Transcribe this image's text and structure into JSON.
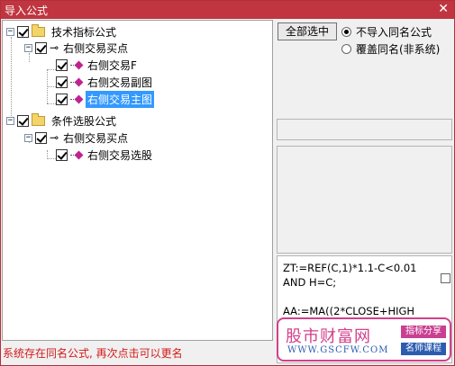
{
  "window": {
    "title": "导入公式",
    "close_glyph": "✕"
  },
  "tree": {
    "nodes": [
      {
        "label": "技术指标公式",
        "checked": true,
        "expander": "−",
        "icon": "folder-icon"
      },
      {
        "label": "右侧交易买点",
        "checked": true,
        "expander": "−",
        "icon": "key-icon"
      },
      {
        "label": "右侧交易F",
        "checked": true,
        "icon": "formula-pen-icon"
      },
      {
        "label": "右侧交易副图",
        "checked": true,
        "icon": "formula-pen-icon"
      },
      {
        "label": "右侧交易主图",
        "checked": true,
        "icon": "formula-pen-icon",
        "selected": true
      },
      {
        "label": "条件选股公式",
        "checked": true,
        "expander": "−",
        "icon": "folder-icon"
      },
      {
        "label": "右侧交易买点",
        "checked": true,
        "expander": "−",
        "icon": "key-icon"
      },
      {
        "label": "右侧交易选股",
        "checked": true,
        "icon": "formula-pen-icon"
      }
    ]
  },
  "buttons": {
    "select_all": "全部选中"
  },
  "options": {
    "no_import_same": "不导入同名公式",
    "overwrite_same": "覆盖同名(非系统)",
    "selected": "no_import_same"
  },
  "code_lines": [
    "ZT:=REF(C,1)*1.1-C<0.01",
    "AND H=C;",
    "",
    "AA:=MA((2*CLOSE+HIGH"
  ],
  "status": "系统存在同名公式, 再次点击可以更名",
  "watermark": {
    "name": "股市财富网",
    "url": "WWW.GSCFW.COM",
    "tag1": "指标分享",
    "tag2": "名师课程"
  },
  "colors": {
    "titlebar": "#c0353f",
    "selection": "#3399ff",
    "status_text": "#d41a1a",
    "watermark_accent": "#d33f8b"
  }
}
